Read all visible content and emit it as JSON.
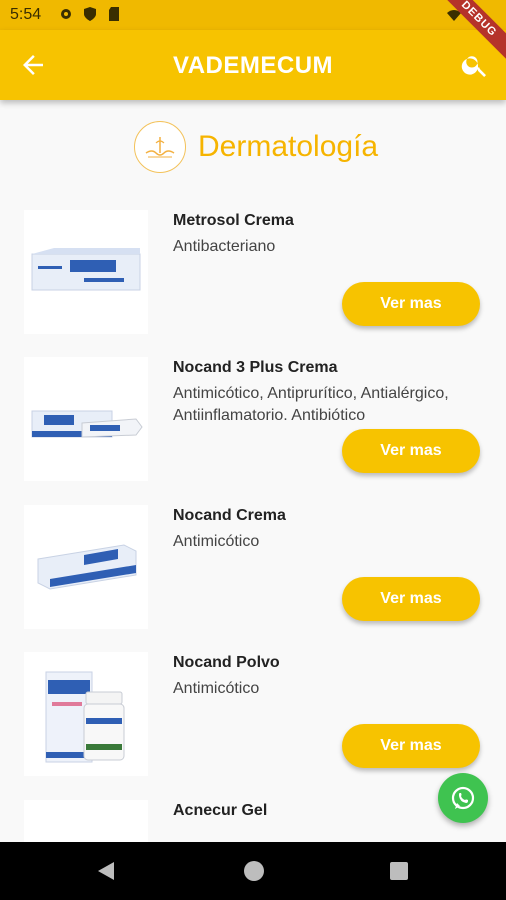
{
  "status_bar": {
    "time": "5:54"
  },
  "debug_banner": "DEBUG",
  "app_bar": {
    "title": "VADEMECUM"
  },
  "category": {
    "title": "Dermatología"
  },
  "products": [
    {
      "name": "Metrosol Crema",
      "description": "Antibacteriano",
      "button": "Ver mas"
    },
    {
      "name": "Nocand 3 Plus Crema",
      "description": "Antimicótico, Antiprurítico, Antialérgico, Antiinflamatorio. Antibiótico",
      "button": "Ver mas"
    },
    {
      "name": "Nocand Crema",
      "description": "Antimicótico",
      "button": "Ver mas"
    },
    {
      "name": "Nocand Polvo",
      "description": "Antimicótico",
      "button": "Ver mas"
    },
    {
      "name": "Acnecur Gel",
      "description": "",
      "button": ""
    }
  ],
  "colors": {
    "primary": "#f7c300",
    "accent_text": "#f6b400",
    "whatsapp": "#3fc350"
  }
}
